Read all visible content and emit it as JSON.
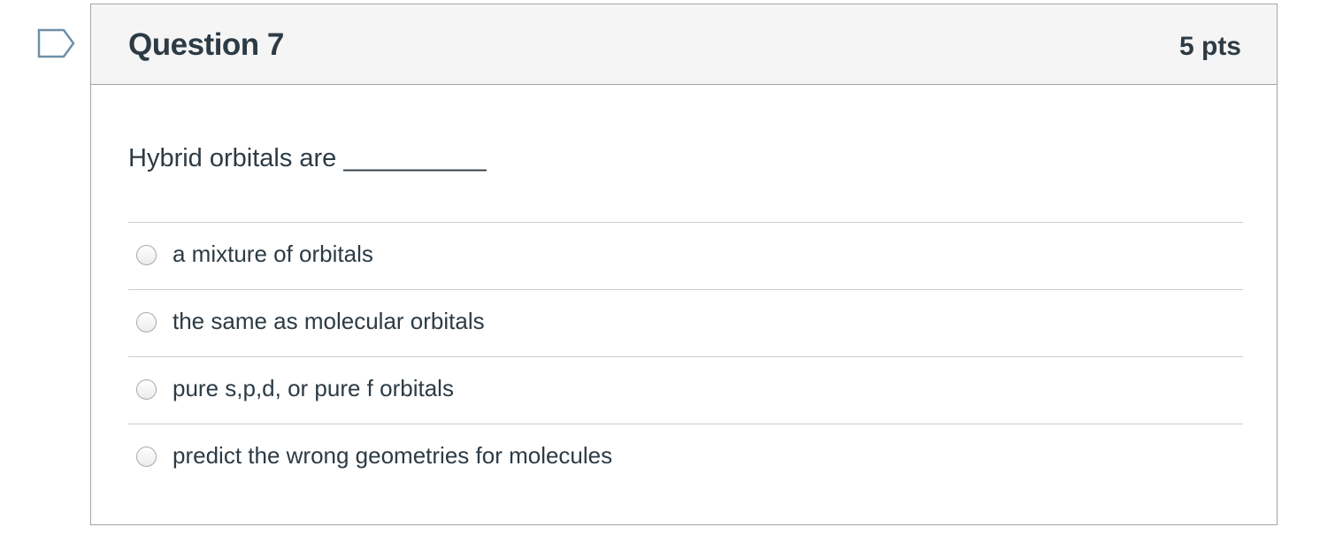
{
  "question": {
    "title": "Question 7",
    "points": "5 pts",
    "text": "Hybrid orbitals are __________",
    "flag_icon": "flag-outline-icon",
    "answers": [
      {
        "label": "a mixture of orbitals",
        "selected": false
      },
      {
        "label": "the same as molecular orbitals",
        "selected": false
      },
      {
        "label": "pure s,p,d, or pure f orbitals",
        "selected": false
      },
      {
        "label": "predict the wrong geometries for molecules",
        "selected": false
      }
    ]
  },
  "colors": {
    "text": "#2d3b45",
    "header_bg": "#f5f5f5",
    "border": "#a5a5a5",
    "flag_outline": "#6f8fa8",
    "divider": "#c7cdd1"
  }
}
